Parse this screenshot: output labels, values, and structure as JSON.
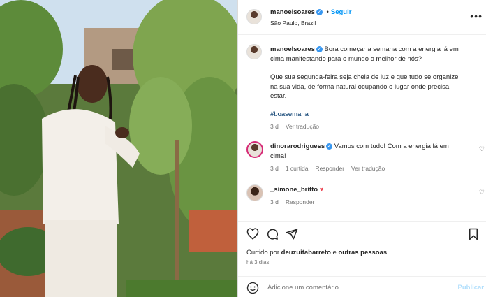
{
  "header": {
    "username": "manoelsoares",
    "follow_label": "Seguir",
    "location": "São Paulo, Brazil",
    "more_label": "•••",
    "verified_mark": "✓"
  },
  "caption": {
    "username": "manoelsoares",
    "line1": "Bora começar a semana com a energia lá em",
    "line2": "cima manifestando para o mundo o melhor de nós?",
    "line3": "Que sua segunda-feira seja cheia de luz e que tudo se organize",
    "line4": "na sua vida, de forma natural ocupando o lugar onde precisa",
    "line5": "estar.",
    "hashtag": "#boasemana",
    "time": "3 d",
    "translate": "Ver tradução"
  },
  "comments": [
    {
      "username": "dinorarodriguess",
      "text_line1": "Vamos com tudo! Com a energia lá em",
      "text_line2": "cima!",
      "time": "3 d",
      "likes": "1 curtida",
      "reply": "Responder",
      "translate": "Ver tradução"
    },
    {
      "username": "_simone_britto",
      "emoji": "♥",
      "time": "3 d",
      "reply": "Responder"
    }
  ],
  "footer": {
    "liked_prefix": "Curtido por",
    "liked_user": "deuzuitabarreto",
    "liked_and": "e",
    "liked_others": "outras pessoas",
    "date": "há 3 dias",
    "comment_placeholder": "Adicione um comentário...",
    "publish_label": "Publicar"
  },
  "colors": {
    "accent": "#0095f6",
    "verified": "#3897f0",
    "heart": "#ed4956",
    "muted": "#737373"
  }
}
